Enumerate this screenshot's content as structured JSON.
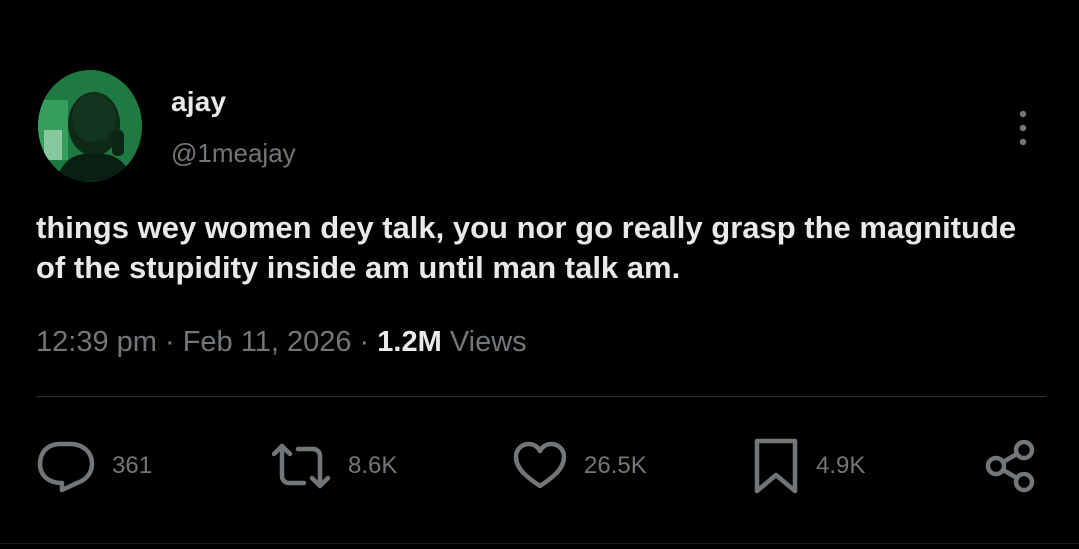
{
  "author": {
    "display_name": "ajay",
    "handle": "@1meajay"
  },
  "tweet": {
    "text": "things wey women dey talk, you nor go really grasp the magnitude of the stupidity inside am until man talk am."
  },
  "meta": {
    "time": "12:39 pm",
    "separator": "·",
    "date": "Feb 11, 2026",
    "views_count": "1.2M",
    "views_label": "Views"
  },
  "actions": {
    "replies": "361",
    "reposts": "8.6K",
    "likes": "26.5K",
    "bookmarks": "4.9K"
  },
  "icons": {
    "reply": "reply-icon",
    "repost": "repost-icon",
    "like": "heart-icon",
    "bookmark": "bookmark-icon",
    "share": "share-icon",
    "more": "more-vertical-icon"
  },
  "colors": {
    "background": "#000000",
    "primary_text": "#e7e9ea",
    "secondary_text": "#71767b",
    "divider": "#2f3336"
  }
}
